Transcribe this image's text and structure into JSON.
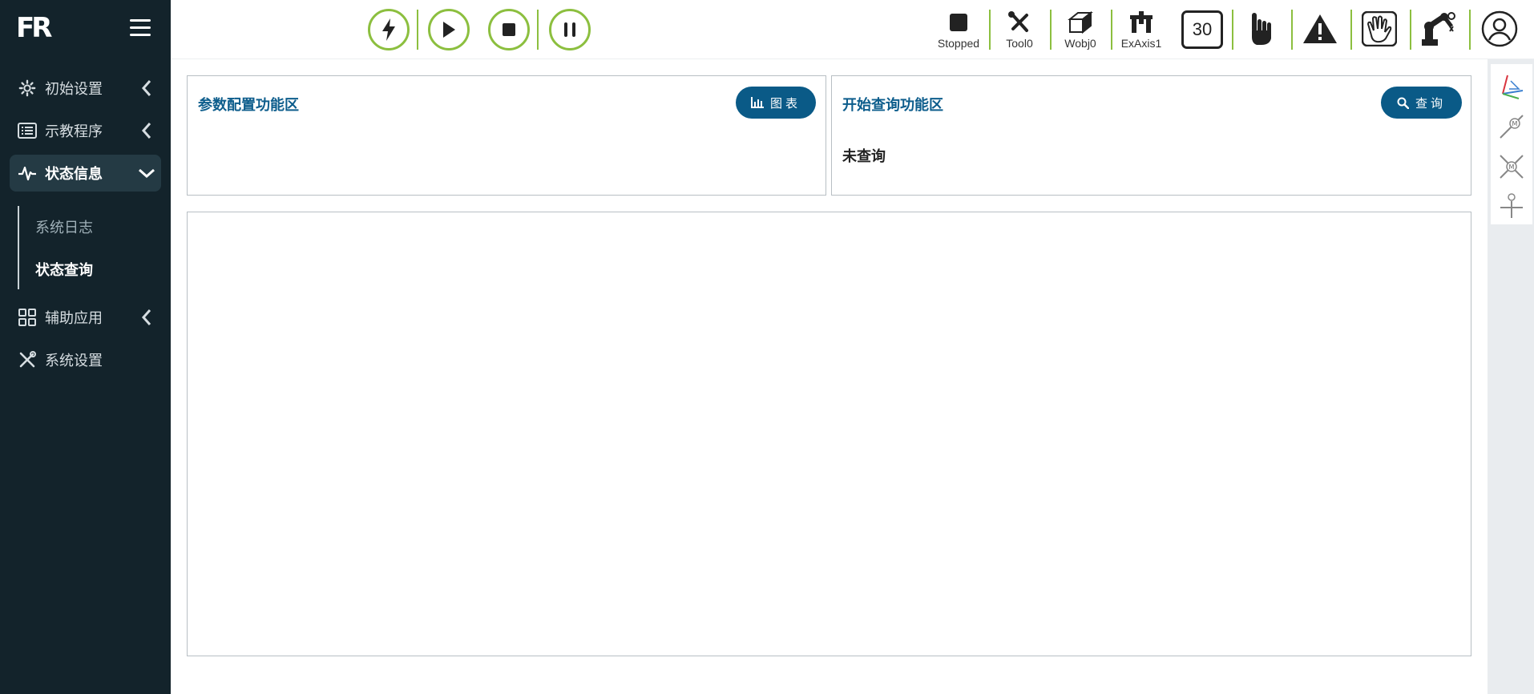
{
  "app": {
    "logo_text": "FR"
  },
  "sidebar": {
    "items": [
      {
        "label": "初始设置",
        "icon": "gear-icon"
      },
      {
        "label": "示教程序",
        "icon": "list-icon"
      },
      {
        "label": "状态信息",
        "icon": "pulse-icon",
        "expanded": true
      },
      {
        "label": "辅助应用",
        "icon": "grid-icon"
      },
      {
        "label": "系统设置",
        "icon": "tools-icon"
      }
    ],
    "sub_items": [
      {
        "label": "系统日志"
      },
      {
        "label": "状态查询",
        "active": true
      }
    ]
  },
  "topbar": {
    "controls": [
      "enable-power",
      "play",
      "stop",
      "pause"
    ],
    "status": {
      "state_label": "Stopped",
      "tool_label": "Tool0",
      "wobj_label": "Wobj0",
      "exaxis_label": "ExAxis1"
    },
    "speed": "30"
  },
  "panels": {
    "param": {
      "title": "参数配置功能区",
      "button_label": "图表"
    },
    "query": {
      "title": "开始查询功能区",
      "button_label": "查询",
      "status_text": "未查询"
    }
  },
  "colors": {
    "sidebar_bg": "#13232b",
    "accent_green": "#8cbf3f",
    "primary_blue": "#0a5a87"
  }
}
